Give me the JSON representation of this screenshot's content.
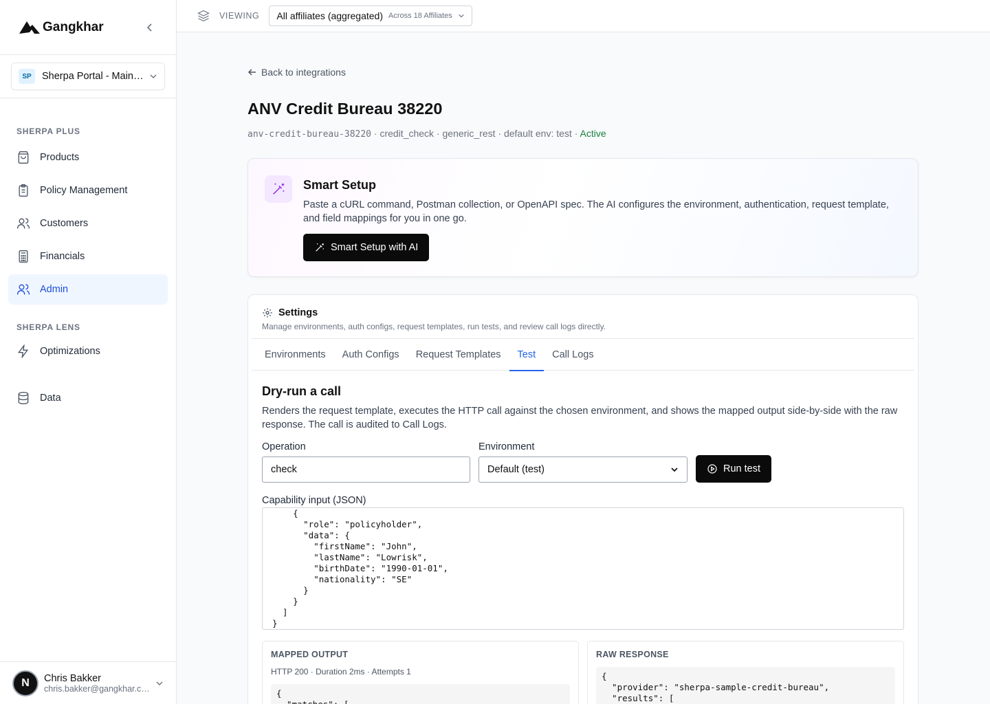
{
  "brand": {
    "name": "Gangkhar"
  },
  "workspace": {
    "initials": "SP",
    "name": "Sherpa Portal - Main…"
  },
  "nav": {
    "section1": "SHERPA PLUS",
    "section2": "SHERPA LENS",
    "items": [
      {
        "label": "Products",
        "icon": "bag-icon"
      },
      {
        "label": "Policy Management",
        "icon": "clipboard-icon"
      },
      {
        "label": "Customers",
        "icon": "users-icon"
      },
      {
        "label": "Financials",
        "icon": "calculator-icon"
      },
      {
        "label": "Admin",
        "icon": "users-icon",
        "active": true
      }
    ],
    "lens_items": [
      {
        "label": "Optimizations",
        "icon": "bolt-icon"
      },
      {
        "label": "Data",
        "icon": "database-icon"
      }
    ]
  },
  "user": {
    "initial": "N",
    "name": "Chris Bakker",
    "email": "chris.bakker@gangkhar.c…"
  },
  "topbar": {
    "viewing": "VIEWING",
    "affiliate": "All affiliates (aggregated)",
    "affiliate_sub": "Across 18 Affiliates"
  },
  "page": {
    "back": "Back to integrations",
    "title": "ANV Credit Bureau 38220",
    "slug": "anv-credit-bureau-38220",
    "meta_rest": " · credit_check · generic_rest · default env: test · ",
    "status": "Active",
    "status_color": "#15803d"
  },
  "smart": {
    "title": "Smart Setup",
    "desc": "Paste a cURL command, Postman collection, or OpenAPI spec. The AI configures the environment, authentication, request template, and field mappings for you in one go.",
    "button": "Smart Setup with AI"
  },
  "settings": {
    "title": "Settings",
    "subtitle": "Manage environments, auth configs, request templates, run tests, and review call logs directly.",
    "tabs": [
      "Environments",
      "Auth Configs",
      "Request Templates",
      "Test",
      "Call Logs"
    ],
    "active_tab": "Test"
  },
  "test": {
    "title": "Dry-run a call",
    "desc": "Renders the request template, executes the HTTP call against the chosen environment, and shows the mapped output side-by-side with the raw response. The call is audited to Call Logs.",
    "operation_label": "Operation",
    "operation_value": "check",
    "environment_label": "Environment",
    "environment_value": "Default (test)",
    "run_button": "Run test",
    "capability_label": "Capability input (JSON)",
    "capability_json": "    {\n      \"role\": \"policyholder\",\n      \"data\": {\n        \"firstName\": \"John\",\n        \"lastName\": \"Lowrisk\",\n        \"birthDate\": \"1990-01-01\",\n        \"nationality\": \"SE\"\n      }\n    }\n  ]\n}"
  },
  "mapped": {
    "title": "MAPPED OUTPUT",
    "meta": "HTTP 200 · Duration 2ms · Attempts 1",
    "code": "{\n  \"matches\": ["
  },
  "raw": {
    "title": "RAW RESPONSE",
    "code": "{\n  \"provider\": \"sherpa-sample-credit-bureau\",\n  \"results\": ["
  },
  "colors": {
    "accent": "#2563eb",
    "primary_button": "#0b0b0b",
    "active_nav_bg": "#eff6ff"
  }
}
